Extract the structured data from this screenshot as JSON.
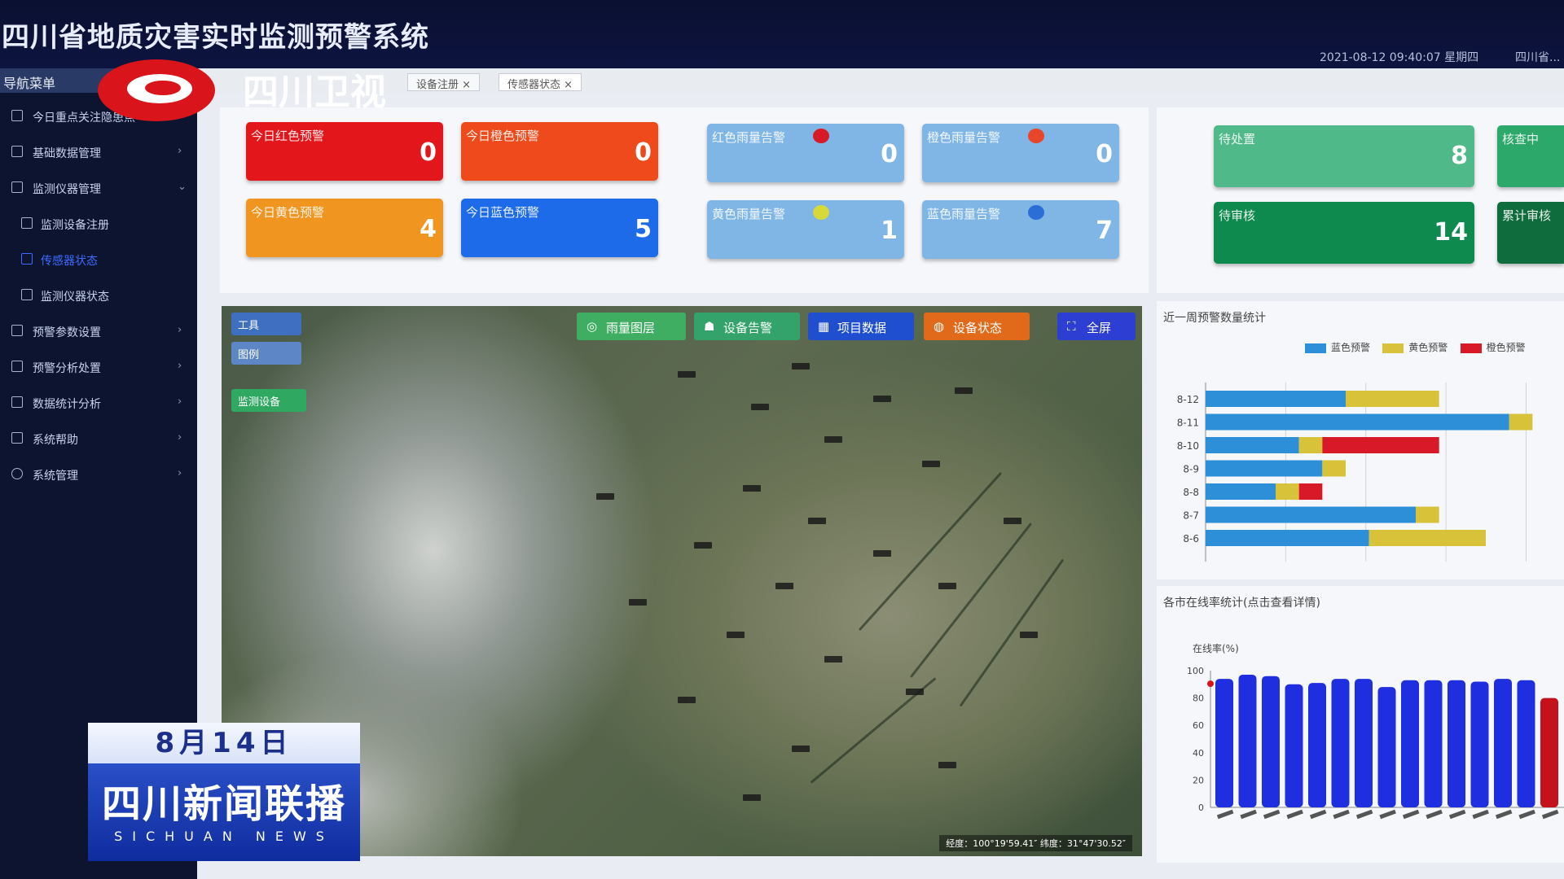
{
  "app": {
    "title": "四川省地质灾害实时监测预警系统",
    "clock": "2021-08-12 09:40:07 星期四",
    "user": "四川省..."
  },
  "sidebar": {
    "header": "导航菜单",
    "items": [
      {
        "label": "今日重点关注隐患点",
        "chevron": ""
      },
      {
        "label": "基础数据管理",
        "chevron": "›"
      },
      {
        "label": "监测仪器管理",
        "chevron": "⌄"
      },
      {
        "label": "监测设备注册",
        "chevron": ""
      },
      {
        "label": "传感器状态",
        "chevron": ""
      },
      {
        "label": "监测仪器状态",
        "chevron": ""
      },
      {
        "label": "预警参数设置",
        "chevron": "›"
      },
      {
        "label": "预警分析处置",
        "chevron": "›"
      },
      {
        "label": "数据统计分析",
        "chevron": "›"
      },
      {
        "label": "系统帮助",
        "chevron": "›"
      },
      {
        "label": "系统管理",
        "chevron": "›"
      }
    ]
  },
  "tabs": [
    {
      "label": "设备注册 ×"
    },
    {
      "label": "传感器状态 ×"
    }
  ],
  "cards": {
    "red_today": {
      "label": "今日红色预警",
      "value": "0",
      "color": "#e3161b"
    },
    "orange_today": {
      "label": "今日橙色预警",
      "value": "0",
      "color": "#ee4a1c"
    },
    "yellow_today": {
      "label": "今日黄色预警",
      "value": "4",
      "color": "#f0951f"
    },
    "blue_today": {
      "label": "今日蓝色预警",
      "value": "5",
      "color": "#1e6bea"
    },
    "red_rain": {
      "label": "红色雨量告警",
      "value": "0",
      "color": "#7fb6e6"
    },
    "orange_rain": {
      "label": "橙色雨量告警",
      "value": "0",
      "color": "#7fb6e6"
    },
    "yellow_rain": {
      "label": "黄色雨量告警",
      "value": "1",
      "color": "#7fb6e6"
    },
    "blue_rain": {
      "label": "蓝色雨量告警",
      "value": "7",
      "color": "#7fb6e6"
    },
    "pending_a": {
      "label": "待处置",
      "value": "8",
      "color": "#4fb98a"
    },
    "pending_b": {
      "label": "待审核",
      "value": "14",
      "color": "#0f8a4e"
    },
    "reviewing": {
      "label": "核查中",
      "value": "",
      "color": "#2ba86a"
    },
    "total_review": {
      "label": "累计审核",
      "value": "",
      "color": "#0f6c3c"
    }
  },
  "map": {
    "chips": [
      {
        "label": "雨量图层",
        "icon": "◎",
        "color": "#3fae62"
      },
      {
        "label": "设备告警",
        "icon": "☗",
        "color": "#33a36b"
      },
      {
        "label": "项目数据",
        "icon": "▦",
        "color": "#1f4fcf"
      },
      {
        "label": "设备状态",
        "icon": "◍",
        "color": "#e06a1a"
      },
      {
        "label": "全屏",
        "icon": "⛶",
        "color": "#2d3fd2"
      }
    ],
    "left_chips": [
      {
        "label": "工具",
        "color": "#3e6fc0"
      },
      {
        "label": "图例",
        "color": "#5d86c7"
      },
      {
        "label": "监测设备",
        "color": "#2fa862"
      }
    ],
    "coords": "经度：100°19'59.41″    纬度：31°47'30.52″"
  },
  "weekly_chart": {
    "title": "近一周预警数量统计",
    "legend": [
      "蓝色预警",
      "黄色预警",
      "橙色预警"
    ],
    "colors": {
      "blue": "#2d8fd8",
      "yellow": "#d7c23a",
      "red": "#d81a28"
    }
  },
  "online_chart": {
    "title": "各市在线率统计(点击查看详情)",
    "ylabel": "在线率(%)"
  },
  "chart_data": [
    {
      "type": "bar",
      "orientation": "horizontal",
      "title": "近一周预警数量统计",
      "categories": [
        "8-12",
        "8-11",
        "8-10",
        "8-9",
        "8-8",
        "8-7",
        "8-6"
      ],
      "series": [
        {
          "name": "蓝色预警",
          "values": [
            6,
            13,
            4,
            5,
            3,
            9,
            7
          ]
        },
        {
          "name": "黄色预警",
          "values": [
            4,
            1,
            1,
            1,
            1,
            1,
            5
          ]
        },
        {
          "name": "橙色预警",
          "values": [
            0,
            0,
            5,
            0,
            1,
            0,
            0
          ]
        }
      ],
      "xlim": [
        0,
        15
      ],
      "grid": true,
      "legend_position": "top-right"
    },
    {
      "type": "bar",
      "title": "各市在线率统计(点击查看详情)",
      "ylabel": "在线率(%)",
      "categories": [
        "",
        "",
        "",
        "",
        "",
        "",
        "",
        "",
        "",
        "",
        "",
        "",
        "",
        "",
        ""
      ],
      "series": [
        {
          "name": "",
          "values": [
            94,
            97,
            96,
            90,
            91,
            94,
            94,
            88,
            93,
            93,
            93,
            92,
            94,
            93,
            80
          ]
        }
      ],
      "ylim": [
        0,
        100
      ],
      "yticks": [
        0,
        20,
        40,
        60,
        80,
        100
      ]
    }
  ],
  "broadcast": {
    "channel": "四川卫视",
    "date": "8月14日",
    "program": "四川新闻联播",
    "program_en": "SICHUAN NEWS"
  }
}
